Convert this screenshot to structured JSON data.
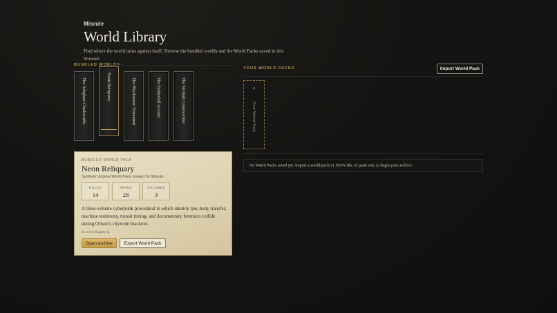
{
  "header": {
    "app_name": "Misrule",
    "title": "World Library",
    "subtitle": "Find where the world turns against itself. Browse the bundled worlds and the World Packs saved in this browser."
  },
  "bundled": {
    "label": "BUNDLED WORLDS",
    "worlds": [
      {
        "title": "The Ashglass Clockworks",
        "selected": false
      },
      {
        "title": "Neon Reliquary",
        "selected": true
      },
      {
        "title": "The Blackwater Testament",
        "selected": false
      },
      {
        "title": "The Emberfall Accord",
        "selected": false
      },
      {
        "title": "The Verdant Convocation",
        "selected": false
      }
    ]
  },
  "your_packs": {
    "label": "YOUR WORLD PACKS",
    "import_label": "Import World Pack",
    "new_pack_plus": "+",
    "new_pack_label": "New World Pack",
    "empty_message": "No World Packs saved yet. Import a world-pack/v1 JSON file, or paste one, to begin your archive."
  },
  "detail": {
    "label": "BUNDLED WORLD PACK",
    "title": "Neon Reliquary",
    "subtitle": "Synthetic original World Pack created for Misrule.",
    "stats": [
      {
        "label": "RULES",
        "value": "14"
      },
      {
        "label": "SPANS",
        "value": "28"
      },
      {
        "label": "VOLUMES",
        "value": "3"
      }
    ],
    "description": "A three-volume cyberpunk procedural in which identity law, body transfer, machine testimony, transit timing, and documentary forensics collide during Orison's citywide blackout.",
    "id_text": "ID neon-reliquary-v1",
    "open_label": "Open archive",
    "export_label": "Export World Pack"
  },
  "colors": {
    "accent_gold": "#c9a553",
    "card_parchment": "#e8dfc4",
    "background": "#141412"
  }
}
